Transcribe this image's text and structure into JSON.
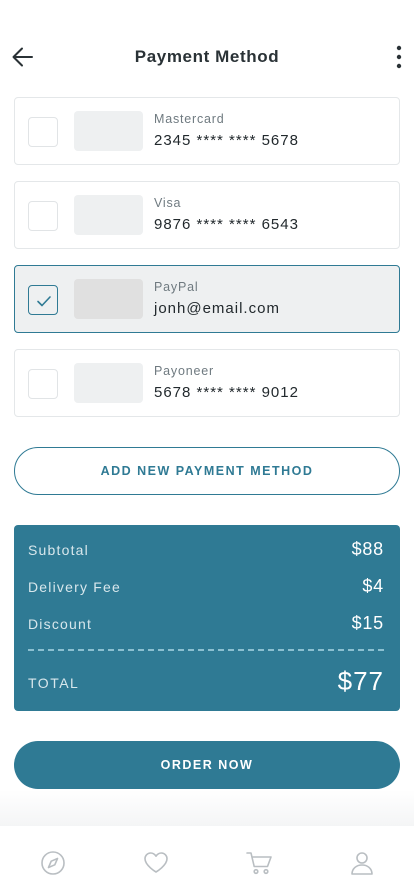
{
  "header": {
    "title": "Payment Method"
  },
  "payment_methods": [
    {
      "name": "Mastercard",
      "number": "2345 **** **** 5678",
      "selected": false
    },
    {
      "name": "Visa",
      "number": "9876 **** **** 6543",
      "selected": false
    },
    {
      "name": "PayPal",
      "number": "jonh@email.com",
      "selected": true
    },
    {
      "name": "Payoneer",
      "number": "5678 **** **** 9012",
      "selected": false
    }
  ],
  "add_button_label": "ADD NEW PAYMENT METHOD",
  "summary": {
    "subtotal_label": "Subtotal",
    "subtotal_value": "$88",
    "delivery_label": "Delivery Fee",
    "delivery_value": "$4",
    "discount_label": "Discount",
    "discount_value": "$15",
    "total_label": "TOTAL",
    "total_value": "$77"
  },
  "order_button_label": "ORDER NOW",
  "tabbar": {
    "items": [
      "compass-icon",
      "heart-icon",
      "cart-icon",
      "user-icon"
    ]
  },
  "colors": {
    "accent": "#2f7a94",
    "selected_bg": "#eef0f1"
  }
}
